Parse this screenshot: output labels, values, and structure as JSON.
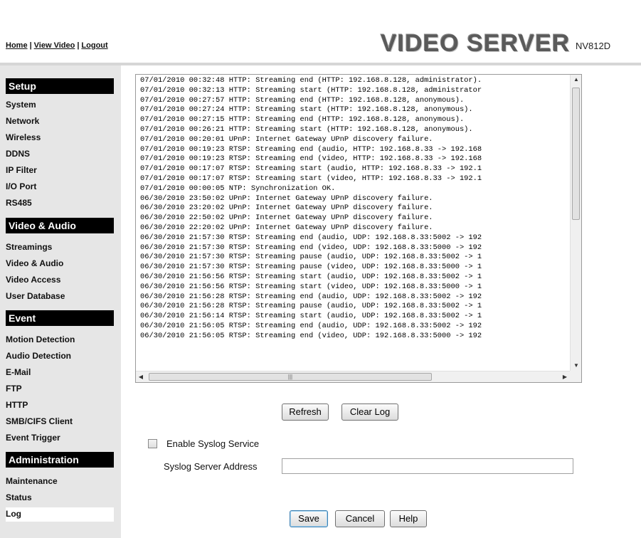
{
  "header": {
    "links": [
      "Home",
      "View Video",
      "Logout"
    ],
    "separator": "|",
    "brand": "VIDEO SERVER",
    "model": "NV812D"
  },
  "sidebar": {
    "sections": [
      {
        "title": "Setup",
        "items": [
          "System",
          "Network",
          "Wireless",
          "DDNS",
          "IP Filter",
          "I/O Port",
          "RS485"
        ]
      },
      {
        "title": "Video & Audio",
        "items": [
          "Streamings",
          "Video & Audio",
          "Video Access",
          "User Database"
        ]
      },
      {
        "title": "Event",
        "items": [
          "Motion Detection",
          "Audio Detection",
          "E-Mail",
          "FTP",
          "HTTP",
          "SMB/CIFS Client",
          "Event Trigger"
        ]
      },
      {
        "title": "Administration",
        "items": [
          "Maintenance",
          "Status",
          "Log"
        ]
      }
    ],
    "active_item": "Log"
  },
  "log": {
    "lines": [
      "07/01/2010 00:32:48 HTTP: Streaming end (HTTP: 192.168.8.128, administrator).",
      "07/01/2010 00:32:13 HTTP: Streaming start (HTTP: 192.168.8.128, administrator",
      "07/01/2010 00:27:57 HTTP: Streaming end (HTTP: 192.168.8.128, anonymous).",
      "07/01/2010 00:27:24 HTTP: Streaming start (HTTP: 192.168.8.128, anonymous).",
      "07/01/2010 00:27:15 HTTP: Streaming end (HTTP: 192.168.8.128, anonymous).",
      "07/01/2010 00:26:21 HTTP: Streaming start (HTTP: 192.168.8.128, anonymous).",
      "07/01/2010 00:20:01 UPnP: Internet Gateway UPnP discovery failure.",
      "07/01/2010 00:19:23 RTSP: Streaming end (audio, HTTP: 192.168.8.33 -> 192.168",
      "07/01/2010 00:19:23 RTSP: Streaming end (video, HTTP: 192.168.8.33 -> 192.168",
      "07/01/2010 00:17:07 RTSP: Streaming start (audio, HTTP: 192.168.8.33 -> 192.1",
      "07/01/2010 00:17:07 RTSP: Streaming start (video, HTTP: 192.168.8.33 -> 192.1",
      "07/01/2010 00:00:05 NTP: Synchronization OK.",
      "06/30/2010 23:50:02 UPnP: Internet Gateway UPnP discovery failure.",
      "06/30/2010 23:20:02 UPnP: Internet Gateway UPnP discovery failure.",
      "06/30/2010 22:50:02 UPnP: Internet Gateway UPnP discovery failure.",
      "06/30/2010 22:20:02 UPnP: Internet Gateway UPnP discovery failure.",
      "06/30/2010 21:57:30 RTSP: Streaming end (audio, UDP: 192.168.8.33:5002 -> 192",
      "06/30/2010 21:57:30 RTSP: Streaming end (video, UDP: 192.168.8.33:5000 -> 192",
      "06/30/2010 21:57:30 RTSP: Streaming pause (audio, UDP: 192.168.8.33:5002 -> 1",
      "06/30/2010 21:57:30 RTSP: Streaming pause (video, UDP: 192.168.8.33:5000 -> 1",
      "06/30/2010 21:56:56 RTSP: Streaming start (audio, UDP: 192.168.8.33:5002 -> 1",
      "06/30/2010 21:56:56 RTSP: Streaming start (video, UDP: 192.168.8.33:5000 -> 1",
      "06/30/2010 21:56:28 RTSP: Streaming end (audio, UDP: 192.168.8.33:5002 -> 192",
      "06/30/2010 21:56:28 RTSP: Streaming pause (audio, UDP: 192.168.8.33:5002 -> 1",
      "06/30/2010 21:56:14 RTSP: Streaming start (audio, UDP: 192.168.8.33:5002 -> 1",
      "06/30/2010 21:56:05 RTSP: Streaming end (audio, UDP: 192.168.8.33:5002 -> 192",
      "06/30/2010 21:56:05 RTSP: Streaming end (video, UDP: 192.168.8.33:5000 -> 192"
    ]
  },
  "buttons": {
    "refresh": "Refresh",
    "clear_log": "Clear Log",
    "save": "Save",
    "cancel": "Cancel",
    "help": "Help"
  },
  "syslog": {
    "enable_label": "Enable Syslog Service",
    "enabled": false,
    "server_label": "Syslog Server Address",
    "server_value": ""
  }
}
